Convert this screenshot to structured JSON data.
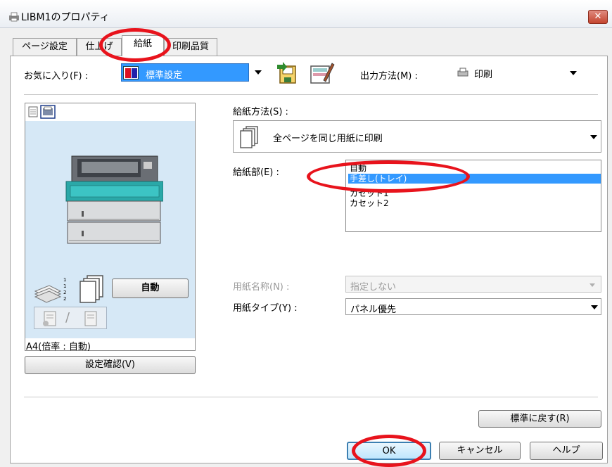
{
  "window": {
    "title": "LIBM1のプロパティ",
    "close_label": "✕",
    "printer_icon": "printer-icon"
  },
  "tabs": [
    {
      "label": "ページ設定"
    },
    {
      "label": "仕上げ"
    },
    {
      "label": "給紙"
    },
    {
      "label": "印刷品質"
    }
  ],
  "favorites": {
    "label": "お気に入り(F) :",
    "value": "標準設定"
  },
  "output": {
    "label": "出力方法(M) :",
    "value": "印刷"
  },
  "paper_feed_method": {
    "label": "給紙方法(S) :",
    "value": "全ページを同じ用紙に印刷"
  },
  "paper_source": {
    "label": "給紙部(E) :",
    "items": [
      "自動",
      "手差し(トレイ)",
      "カセット1",
      "カセット2"
    ],
    "selected_index": 1
  },
  "paper_name": {
    "label": "用紙名称(N) :",
    "value": "指定しない"
  },
  "paper_type": {
    "label": "用紙タイプ(Y) :",
    "value": "パネル優先"
  },
  "preview": {
    "auto_button": "自動",
    "status": "A4(倍率 : 自動)",
    "confirm_button": "設定確認(V)",
    "page_numbers": "1 1 2 2"
  },
  "buttons": {
    "restore_defaults": "標準に戻す(R)",
    "ok": "OK",
    "cancel": "キャンセル",
    "help": "ヘルプ"
  },
  "colors": {
    "selection": "#3399ff",
    "annotation_ring": "#e8131c",
    "preview_bg": "#d6e8f6",
    "printer_accent": "#2aa8a8"
  }
}
